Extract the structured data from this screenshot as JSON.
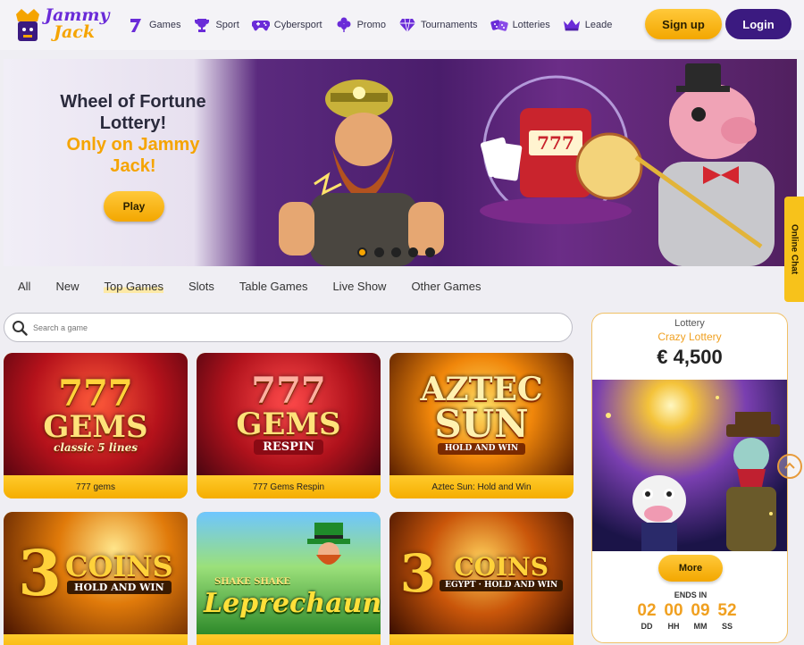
{
  "brand": {
    "logo_line1": "Jammy",
    "logo_line2": "Jack"
  },
  "nav": {
    "items": [
      {
        "label": "Games",
        "icon": "seven-icon"
      },
      {
        "label": "Sport",
        "icon": "trophy-icon"
      },
      {
        "label": "Cybersport",
        "icon": "gamepad-icon"
      },
      {
        "label": "Promo",
        "icon": "clover-icon"
      },
      {
        "label": "Tournaments",
        "icon": "diamond-icon"
      },
      {
        "label": "Lotteries",
        "icon": "dice-icon"
      },
      {
        "label": "Leade",
        "icon": "crown-icon"
      }
    ],
    "signup": "Sign up",
    "login": "Login"
  },
  "banner": {
    "line1": "Wheel of Fortune",
    "line2": "Lottery!",
    "line3": "Only on Jammy",
    "line4": "Jack!",
    "play": "Play",
    "slides": 5,
    "active_slide": 1
  },
  "online_chat": "Online Chat",
  "tabs": [
    "All",
    "New",
    "Top Games",
    "Slots",
    "Table Games",
    "Live Show",
    "Other Games"
  ],
  "active_tab": "Top Games",
  "search": {
    "placeholder": "Search a game"
  },
  "games": [
    {
      "caption": "777 gems",
      "art_title": "777",
      "art_sub": "GEMS",
      "art_sub2": "classic 5 lines"
    },
    {
      "caption": "777 Gems Respin",
      "art_title": "777",
      "art_sub": "GEMS",
      "art_sub2": "RESPIN"
    },
    {
      "caption": "Aztec Sun: Hold and Win",
      "art_title": "AZTEC",
      "art_sub": "SUN",
      "art_sub2": "HOLD AND WIN"
    },
    {
      "caption": "",
      "art_title": "3",
      "art_sub": "COINS",
      "art_sub2": "HOLD AND WIN"
    },
    {
      "caption": "",
      "art_title": "SHAKE SHAKE",
      "art_sub": "Leprechaun",
      "art_sub2": ""
    },
    {
      "caption": "",
      "art_title": "3",
      "art_sub": "COINS",
      "art_sub2": "EGYPT · HOLD AND WIN"
    }
  ],
  "lottery": {
    "label": "Lottery",
    "name": "Crazy Lottery",
    "amount": "€ 4,500",
    "more": "More",
    "ends_in": "ENDS IN",
    "timer": [
      {
        "value": "02",
        "unit": "DD"
      },
      {
        "value": "00",
        "unit": "HH"
      },
      {
        "value": "09",
        "unit": "MM"
      },
      {
        "value": "52",
        "unit": "SS"
      }
    ]
  },
  "colors": {
    "accent": "#f5a400",
    "login": "#3b1a80",
    "background": "#efeef3"
  }
}
